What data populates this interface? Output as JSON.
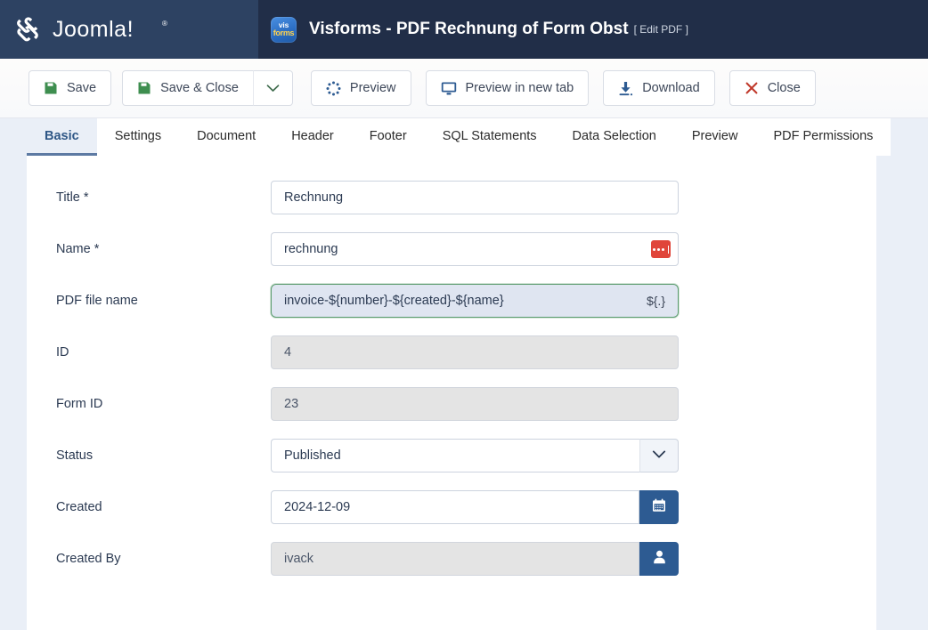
{
  "header": {
    "brand": "Joomla!",
    "brand_icon": "joomla-logo-icon",
    "app_badge_line1": "vis",
    "app_badge_line2": "forms",
    "title": "Visforms - PDF Rechnung of Form Obst",
    "subtitle": "[ Edit PDF ]"
  },
  "toolbar": {
    "save_label": "Save",
    "save_close_label": "Save & Close",
    "save_close_caret_icon": "chevron-down-icon",
    "preview_label": "Preview",
    "preview_icon": "spinner-dots-icon",
    "preview_new_tab_label": "Preview in new tab",
    "preview_new_tab_icon": "monitor-icon",
    "download_label": "Download",
    "download_icon": "download-icon",
    "close_label": "Close",
    "close_icon": "close-x-icon",
    "save_icon": "floppy-disk-icon"
  },
  "tabs": [
    {
      "label": "Basic",
      "active": true
    },
    {
      "label": "Settings",
      "active": false
    },
    {
      "label": "Document",
      "active": false
    },
    {
      "label": "Header",
      "active": false
    },
    {
      "label": "Footer",
      "active": false
    },
    {
      "label": "SQL Statements",
      "active": false
    },
    {
      "label": "Data Selection",
      "active": false
    },
    {
      "label": "Preview",
      "active": false
    },
    {
      "label": "PDF Permissions",
      "active": false
    }
  ],
  "form": {
    "title": {
      "label": "Title *",
      "value": "Rechnung"
    },
    "name": {
      "label": "Name *",
      "value": "rechnung",
      "icon": "password-dots-icon"
    },
    "pdf_file_name": {
      "label": "PDF file name",
      "value": "invoice-${number}-${created}-${name}",
      "suffix": "${.}",
      "focused": true
    },
    "id": {
      "label": "ID",
      "value": "4",
      "readonly": true
    },
    "form_id": {
      "label": "Form ID",
      "value": "23",
      "readonly": true
    },
    "status": {
      "label": "Status",
      "value": "Published",
      "caret_icon": "chevron-down-icon"
    },
    "created": {
      "label": "Created",
      "value": "2024-12-09",
      "addon_icon": "calendar-icon"
    },
    "created_by": {
      "label": "Created By",
      "value": "ivack",
      "readonly": true,
      "addon_icon": "user-icon"
    }
  },
  "colors": {
    "header_left": "#2d4262",
    "header_right": "#212e48",
    "page_background": "#eaeff7",
    "accent_blue": "#2d5b92",
    "save_green": "#3e8e4f",
    "danger_red": "#e0453a",
    "focus_green": "#5b9c6e"
  }
}
